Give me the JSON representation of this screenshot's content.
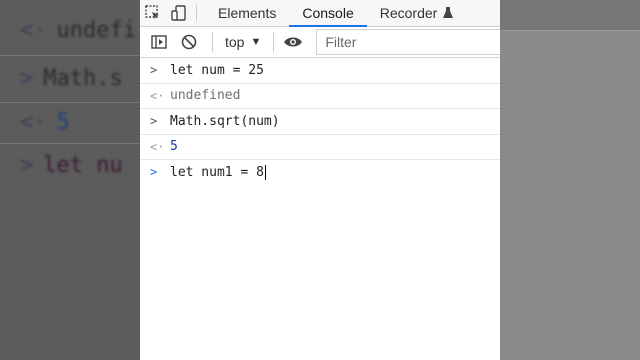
{
  "background": {
    "lines": [
      {
        "prefix": "<·",
        "text": "undefi"
      },
      {
        "prefix": ">",
        "text": "Math.s"
      },
      {
        "prefix": "<·",
        "text": "5"
      },
      {
        "prefix": ">",
        "text": "let nu"
      }
    ]
  },
  "devtools": {
    "tabs": [
      {
        "label": "Elements"
      },
      {
        "label": "Console"
      },
      {
        "label": "Recorder"
      }
    ],
    "toolbar": {
      "context_label": "top",
      "filter_placeholder": "Filter"
    },
    "console": {
      "entries": [
        {
          "type": "input",
          "prompt": ">",
          "text": "let num = 25"
        },
        {
          "type": "output",
          "prompt": "<·",
          "text": "undefined"
        },
        {
          "type": "input",
          "prompt": ">",
          "text": "Math.sqrt(num)"
        },
        {
          "type": "output",
          "prompt": "<·",
          "text": "5"
        },
        {
          "type": "prompt",
          "prompt": ">",
          "text": "let num1 = 8"
        }
      ]
    }
  },
  "colors": {
    "accent": "#1a73e8",
    "number": "#1a3aa6"
  },
  "icons": [
    "inspect-icon",
    "device-toggle-icon",
    "recorder-flask-icon",
    "sidebar-toggle-icon",
    "clear-console-icon",
    "dropdown-caret-icon",
    "live-expression-eye-icon"
  ]
}
